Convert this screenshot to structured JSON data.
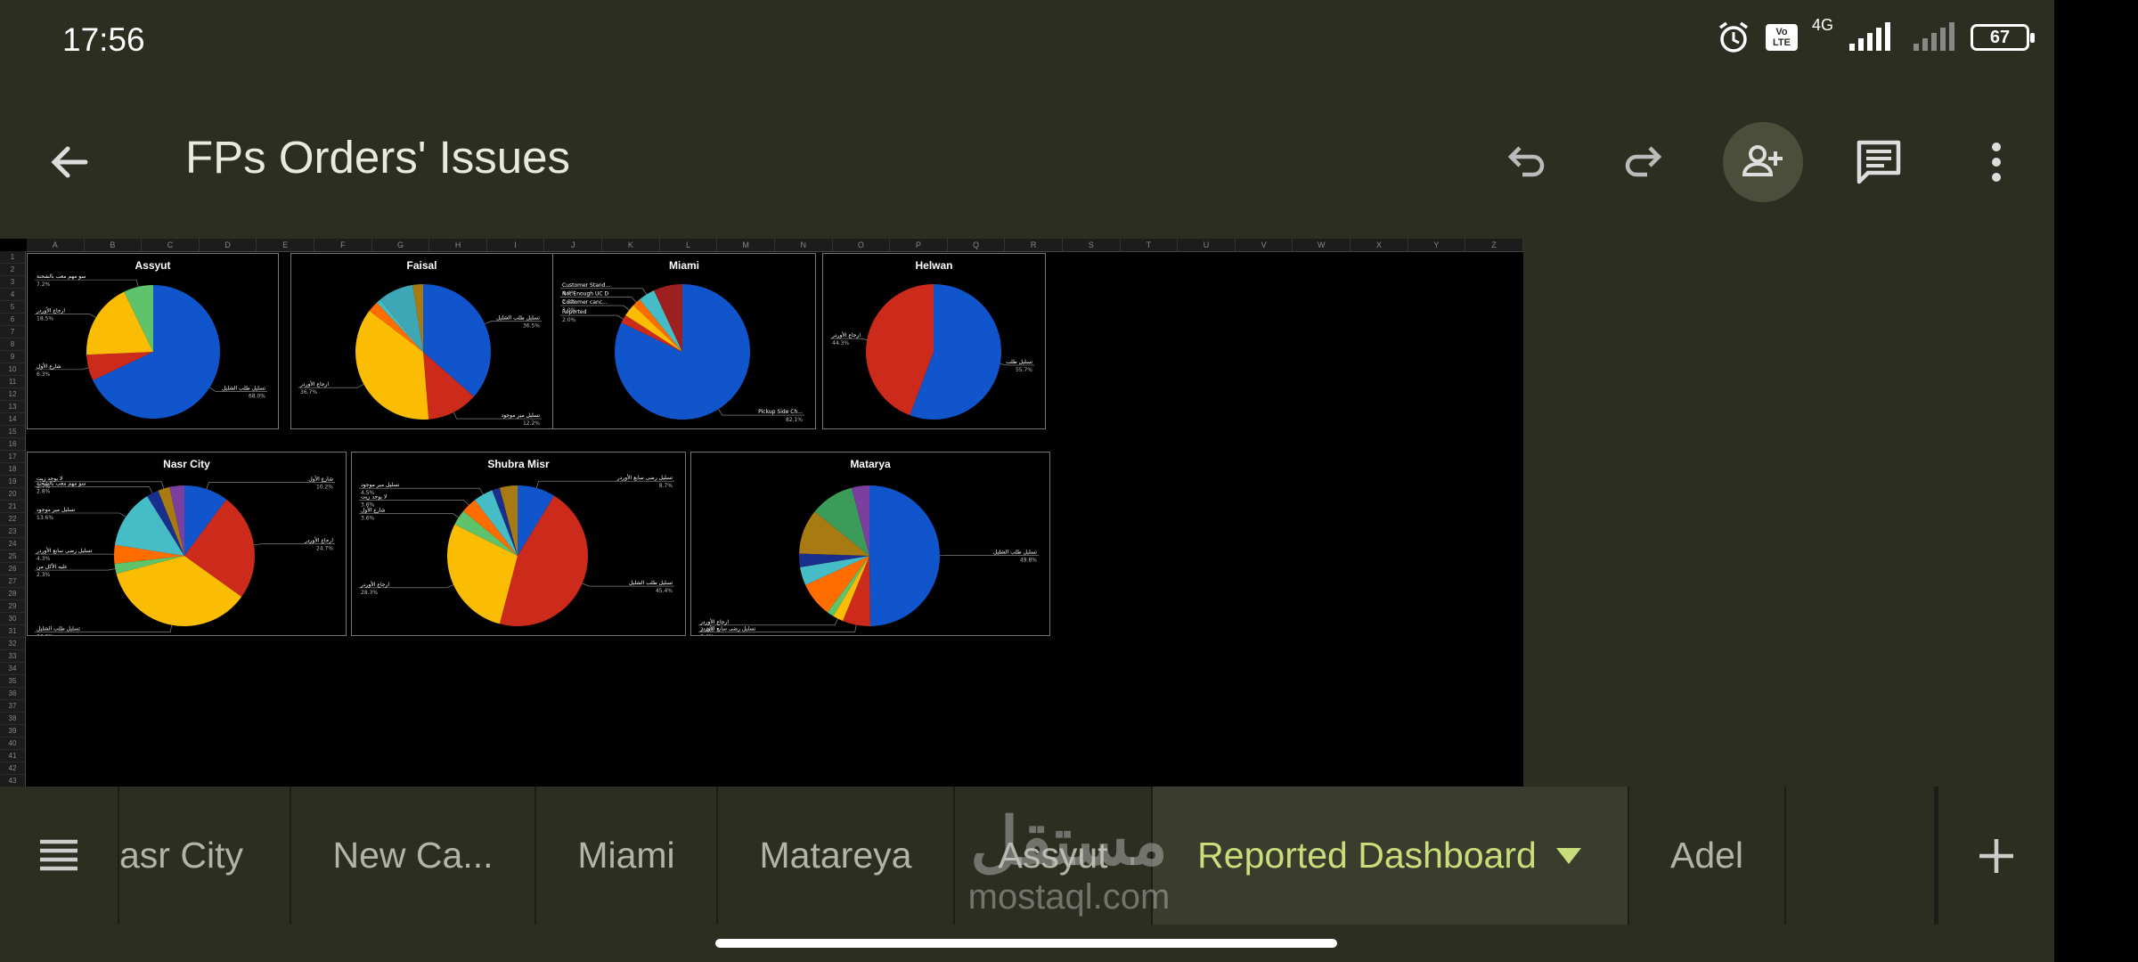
{
  "status": {
    "time": "17:56",
    "network": "4G",
    "volte": "Vo LTE",
    "battery": "67"
  },
  "toolbar": {
    "title": "FPs Orders' Issues"
  },
  "sheet": {
    "columns": [
      "A",
      "B",
      "C",
      "D",
      "E",
      "F",
      "G",
      "H",
      "I",
      "J",
      "K",
      "L",
      "M",
      "N",
      "O",
      "P",
      "Q",
      "R",
      "S",
      "T",
      "U",
      "V",
      "W",
      "X",
      "Y",
      "Z"
    ]
  },
  "charts": [
    {
      "id": "assyut",
      "title": "Assyut"
    },
    {
      "id": "faisal",
      "title": "Faisal"
    },
    {
      "id": "miami",
      "title": "Miami"
    },
    {
      "id": "helwan",
      "title": "Helwan"
    },
    {
      "id": "nasr",
      "title": "Nasr City"
    },
    {
      "id": "shubra",
      "title": "Shubra Misr"
    },
    {
      "id": "matarya",
      "title": "Matarya"
    }
  ],
  "chart_data": [
    {
      "type": "pie",
      "title": "Assyut",
      "slices": [
        {
          "label": "تسليل طلب الشليل",
          "value": 68.0,
          "color": "#1155cc"
        },
        {
          "label": "شارع الأول",
          "value": 6.3,
          "color": "#cc2a1a"
        },
        {
          "label": "ارجاع الأوردر",
          "value": 18.5,
          "color": "#fbbc04"
        },
        {
          "label": "سو مهم معب بالشحنة",
          "value": 7.2,
          "color": "#5ec36a"
        }
      ]
    },
    {
      "type": "pie",
      "title": "Faisal",
      "slices": [
        {
          "label": "تسليل طلب الشليل",
          "value": 36.5,
          "color": "#1155cc"
        },
        {
          "label": "تسليل مير موجود",
          "value": 12.2,
          "color": "#cc2a1a"
        },
        {
          "label": "ارجاع الأوردر",
          "value": 36.7,
          "color": "#fbbc04"
        },
        {
          "label": "",
          "value": 2.6,
          "color": "#ff6d01"
        },
        {
          "label": "",
          "value": 1.0,
          "color": "#46bdc6"
        },
        {
          "label": "",
          "value": 8.5,
          "color": "#3ea7b5"
        },
        {
          "label": "",
          "value": 2.5,
          "color": "#a87b12"
        }
      ]
    },
    {
      "type": "pie",
      "title": "Miami",
      "slices": [
        {
          "label": "Pickup Side Ch...",
          "value": 82.1,
          "color": "#1155cc"
        },
        {
          "label": "Reported",
          "value": 2.0,
          "color": "#cc2a1a"
        },
        {
          "label": "Customer canc...",
          "value": 3.0,
          "color": "#fbbc04"
        },
        {
          "label": "Not Enough UC D",
          "value": 2.0,
          "color": "#ff6d01"
        },
        {
          "label": "Customer Stand...",
          "value": 4.0,
          "color": "#46bdc6"
        },
        {
          "label": "",
          "value": 6.9,
          "color": "#9e1f1f"
        }
      ]
    },
    {
      "type": "pie",
      "title": "Helwan",
      "slices": [
        {
          "label": "تسليل طلب",
          "value": 55.7,
          "color": "#1155cc"
        },
        {
          "label": "ارجاع الأوردر",
          "value": 44.3,
          "color": "#cc2a1a"
        }
      ]
    },
    {
      "type": "pie",
      "title": "Nasr City",
      "slices": [
        {
          "label": "شارع الأول",
          "value": 10.2,
          "color": "#1155cc"
        },
        {
          "label": "ارجاع الأوردر",
          "value": 24.7,
          "color": "#cc2a1a"
        },
        {
          "label": "تسليل طلب الشليل",
          "value": 36.0,
          "color": "#fbbc04"
        },
        {
          "label": "عليه الأكل من",
          "value": 2.3,
          "color": "#5ec36a"
        },
        {
          "label": "تسليل رضى سابع الأوردر",
          "value": 4.3,
          "color": "#ff6d01"
        },
        {
          "label": "تسليل مير موجود",
          "value": 13.6,
          "color": "#46bdc6"
        },
        {
          "label": "سو مهم معب بالشحنة",
          "value": 2.8,
          "color": "#1a2e8c"
        },
        {
          "label": "لا يوجد زيت",
          "value": 2.7,
          "color": "#a87b12"
        },
        {
          "label": "",
          "value": 3.4,
          "color": "#7b3fa0"
        }
      ]
    },
    {
      "type": "pie",
      "title": "Shubra Misr",
      "slices": [
        {
          "label": "تسليل رضى سابع الأوردر",
          "value": 8.7,
          "color": "#1155cc"
        },
        {
          "label": "تسليل طلب الشليل",
          "value": 45.4,
          "color": "#cc2a1a"
        },
        {
          "label": "ارجاع الأوردر",
          "value": 28.3,
          "color": "#fbbc04"
        },
        {
          "label": "شارع الأول",
          "value": 3.6,
          "color": "#5ec36a"
        },
        {
          "label": "لا يوجد زيت",
          "value": 3.6,
          "color": "#ff6d01"
        },
        {
          "label": "تسليل مير موجود",
          "value": 4.5,
          "color": "#46bdc6"
        },
        {
          "label": "",
          "value": 1.8,
          "color": "#1a2e8c"
        },
        {
          "label": "",
          "value": 4.1,
          "color": "#a87b12"
        }
      ]
    },
    {
      "type": "pie",
      "title": "Matarya",
      "slices": [
        {
          "label": "تسليل طلب الشليل",
          "value": 49.8,
          "color": "#1155cc"
        },
        {
          "label": "تسليل رضى سابع الأوردر",
          "value": 6.4,
          "color": "#cc2a1a"
        },
        {
          "label": "ارجاع الأوردر",
          "value": 2.4,
          "color": "#fbbc04"
        },
        {
          "label": "",
          "value": 1.6,
          "color": "#5ec36a"
        },
        {
          "label": "",
          "value": 8.0,
          "color": "#ff6d01"
        },
        {
          "label": "",
          "value": 4.2,
          "color": "#46bdc6"
        },
        {
          "label": "",
          "value": 3.1,
          "color": "#1a2e8c"
        },
        {
          "label": "",
          "value": 10.3,
          "color": "#a87b12"
        },
        {
          "label": "",
          "value": 10.1,
          "color": "#3b9c5a"
        },
        {
          "label": "",
          "value": 4.1,
          "color": "#7b3fa0"
        }
      ]
    }
  ],
  "tabs": [
    {
      "label": "asr City"
    },
    {
      "label": "New Ca..."
    },
    {
      "label": "Miami"
    },
    {
      "label": "Matareya"
    },
    {
      "label": "Assyut"
    },
    {
      "label": "Reported Dashboard"
    },
    {
      "label": "Adel"
    }
  ],
  "watermark": {
    "ar": "مستقل",
    "en": "mostaql.com"
  },
  "colors": {
    "chrome": "#2c2e22",
    "active_tab": "#c9de7a",
    "accent_circle": "#4b4e3b"
  }
}
